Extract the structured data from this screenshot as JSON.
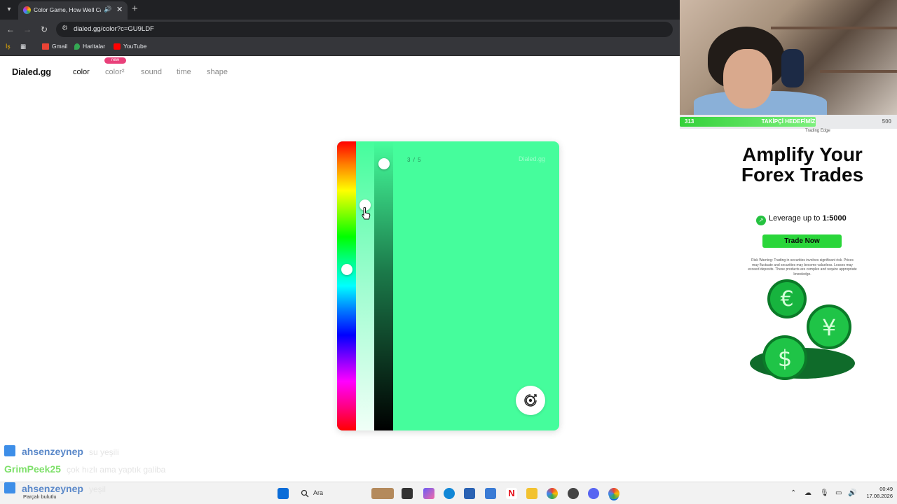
{
  "browser": {
    "tab_title": "Color Game, How Well Can",
    "url": "dialed.gg/color?c=GU9LDF",
    "bookmarks": [
      {
        "label": "Gmail",
        "icon": "gmail-icon"
      },
      {
        "label": "Haritalar",
        "icon": "maps-icon"
      },
      {
        "label": "YouTube",
        "icon": "youtube-icon"
      }
    ],
    "bookmark_prefix": "İş"
  },
  "site": {
    "logo": "Dialed.gg",
    "nav": [
      "color",
      "color²",
      "sound",
      "time",
      "shape"
    ],
    "new_badge": "new",
    "active_nav": "color"
  },
  "game": {
    "progress": "3 / 5",
    "watermark": "Dialed.gg",
    "current_color": "#45fd9c",
    "hue_knob_fraction": 0.44,
    "saturation_knob_fraction": 0.21,
    "brightness_knob_fraction": 0.06
  },
  "chat": [
    {
      "user": "ahsenzeynep",
      "message": "su yeşili",
      "color": "#5a88c9"
    },
    {
      "user": "GrimPeek25",
      "message": "çok hızlı ama yaptık galiba",
      "color": "#7ee06a"
    },
    {
      "user": "ahsenzeynep",
      "message": "yeşil",
      "color": "#5a88c9"
    }
  ],
  "stream": {
    "follow_current": "313",
    "follow_goal": "500",
    "follow_title": "TAKİPÇİ HEDEFİMİZ",
    "follow_fraction": 0.626
  },
  "ad": {
    "tag": "Trading Edge",
    "headline": "Amplify Your Forex Trades",
    "leverage_prefix": "Leverage up to ",
    "leverage_value": "1:5000",
    "cta": "Trade Now",
    "risk": "Risk Warning: Trading in securities involves significant risk. Prices may fluctuate and securities may become valueless. Losses may exceed deposits. These products are complex and require appropriate knowledge."
  },
  "taskbar": {
    "weather": "Parçalı bulutlu",
    "search_placeholder": "Ara",
    "time": "00:49",
    "date": "17.08.2026"
  }
}
